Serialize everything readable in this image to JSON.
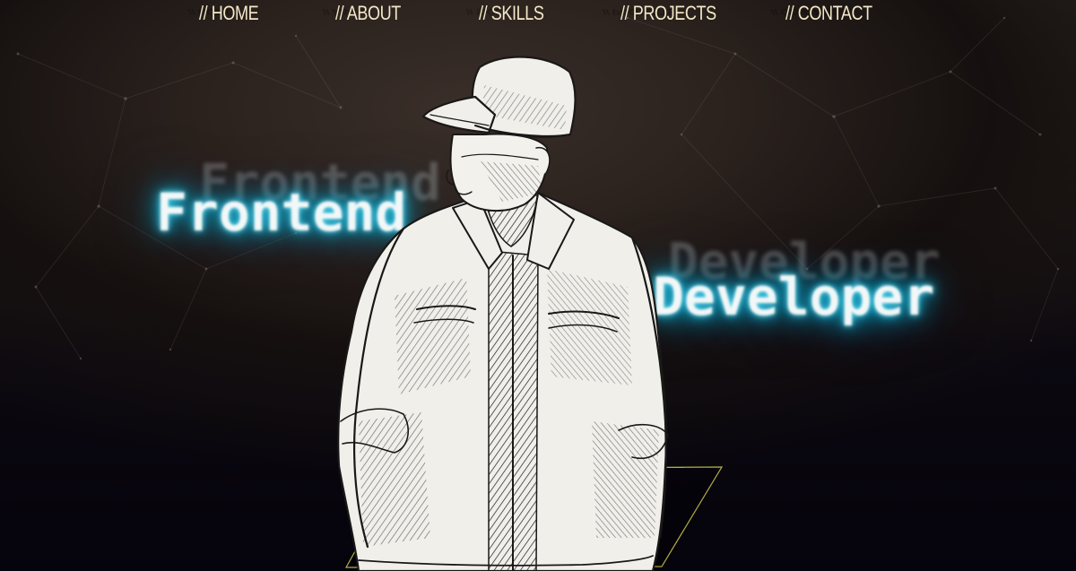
{
  "nav": {
    "items": [
      {
        "label": "// HOME"
      },
      {
        "label": "// ABOUT"
      },
      {
        "label": "// SKILLS"
      },
      {
        "label": "// PROJECTS"
      },
      {
        "label": "// CONTACT"
      }
    ],
    "color": "#f3e9c8"
  },
  "hero": {
    "line1": "Frontend",
    "line2": "Developer",
    "glow_color": "#18c4e8"
  },
  "illustration": {
    "subject": "sketched-man-in-cap-and-jacket-icon",
    "floor_outline_color": "#c9c24a"
  }
}
